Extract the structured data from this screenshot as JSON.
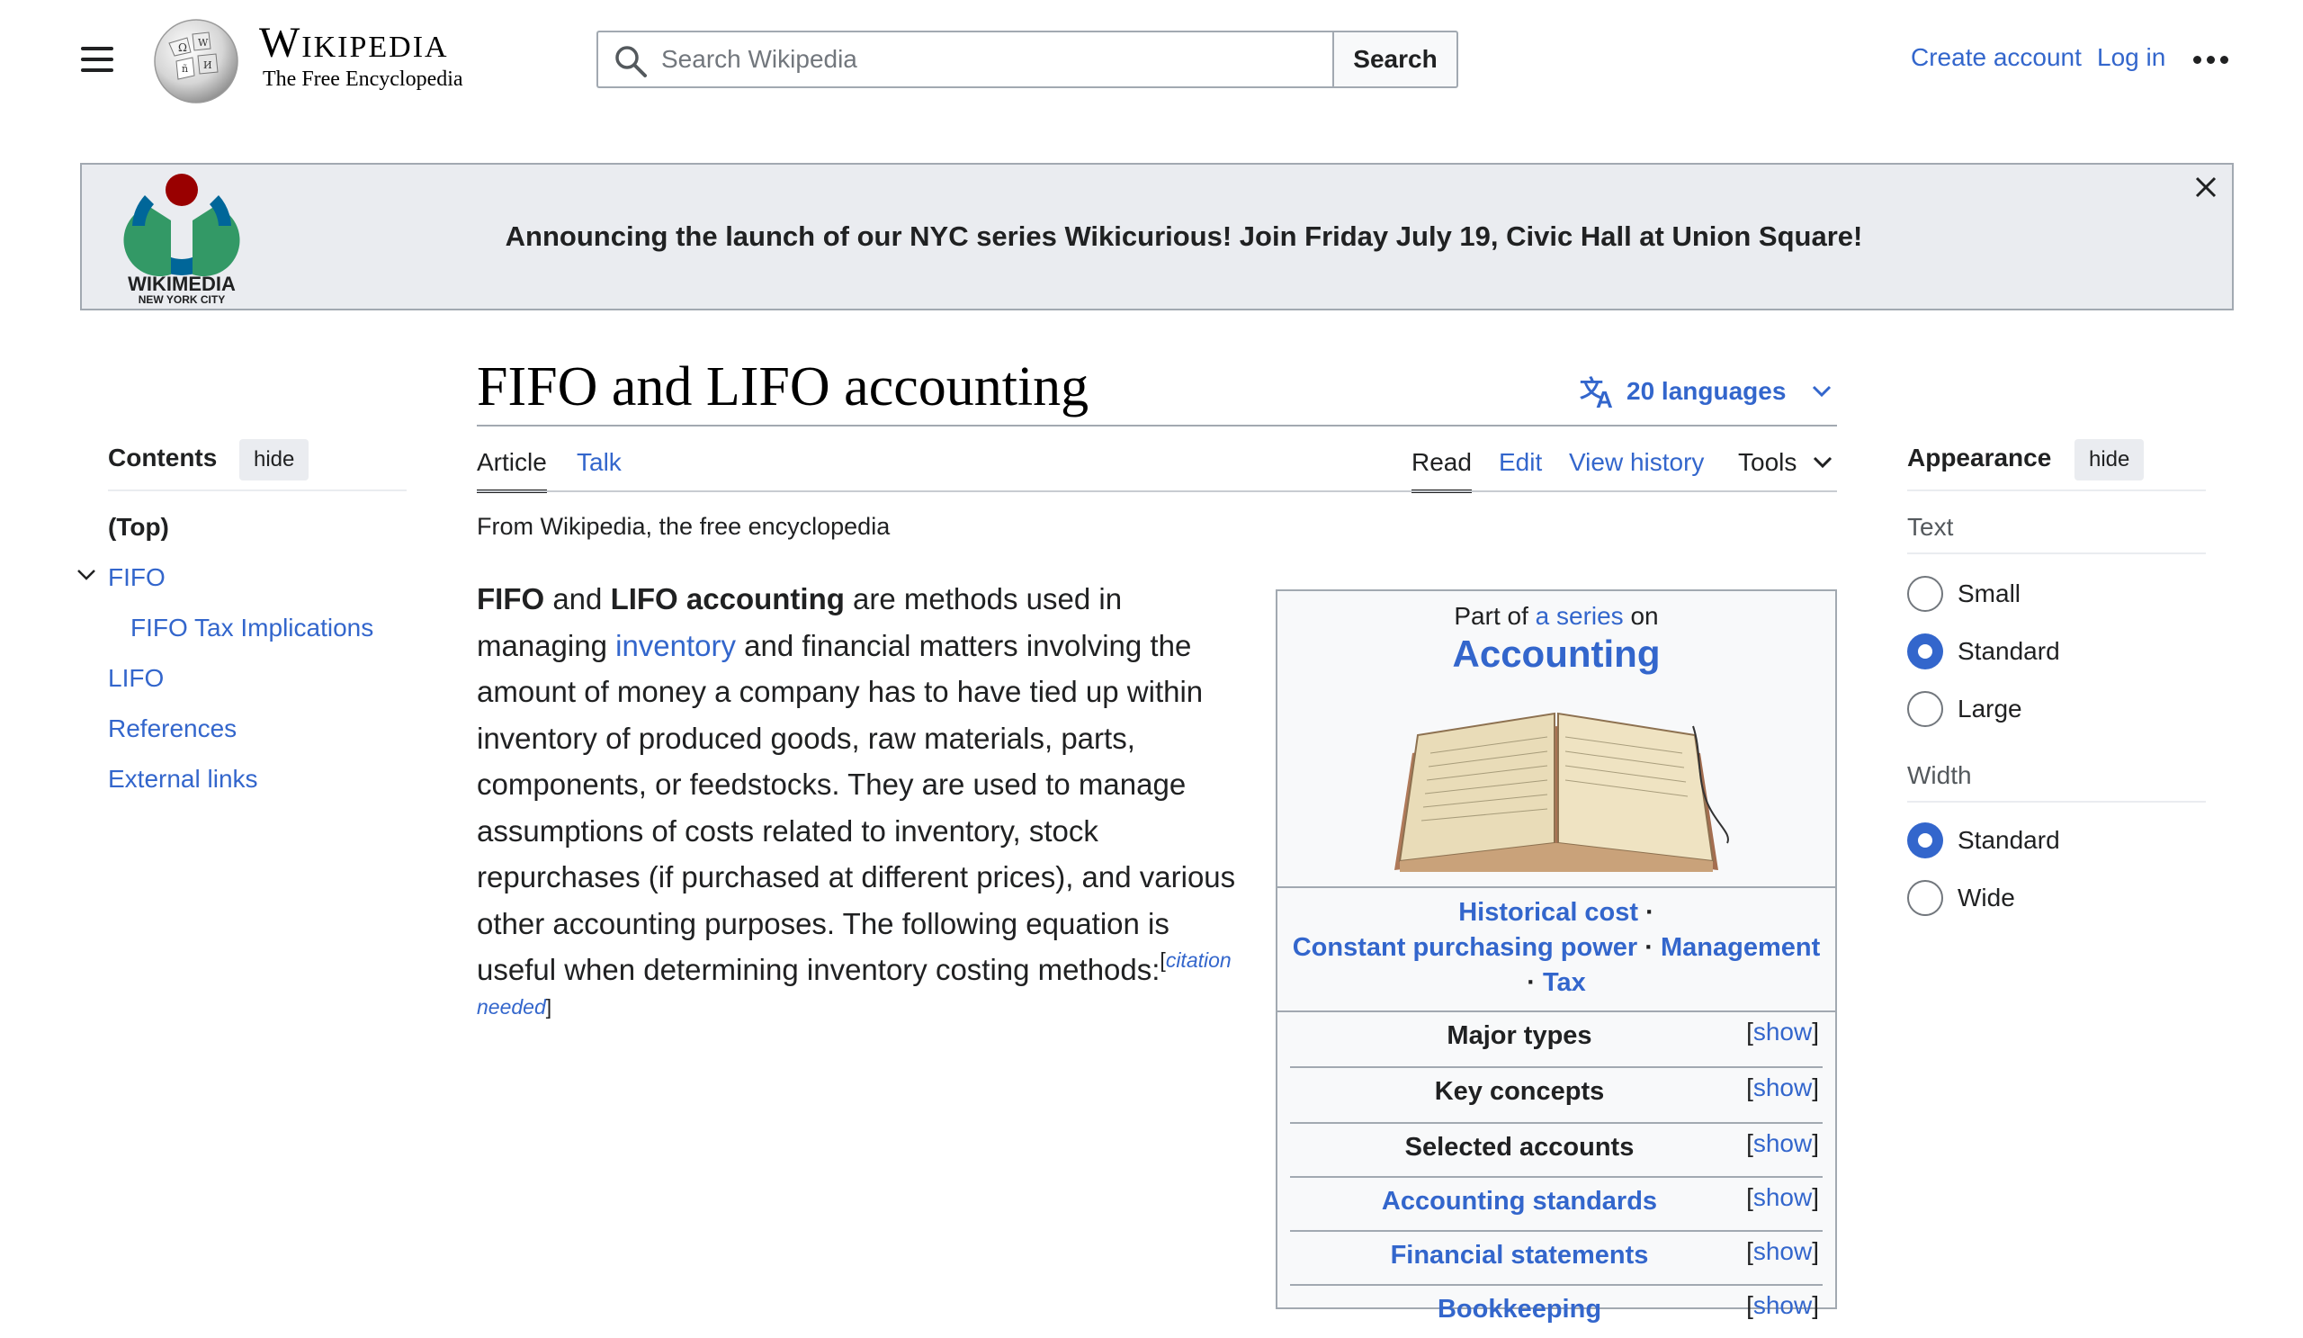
{
  "header": {
    "wordmark_title": "Wikipedia",
    "wordmark_tagline": "The Free Encyclopedia",
    "search_placeholder": "Search Wikipedia",
    "search_button": "Search",
    "create_account": "Create account",
    "log_in": "Log in"
  },
  "banner": {
    "logo_text": "WIKIMEDIA",
    "logo_subtext": "NEW YORK CITY",
    "message": "Announcing the launch of our NYC series Wikicurious! Join Friday July 19, Civic Hall at Union Square!"
  },
  "page": {
    "title": "FIFO and LIFO accounting",
    "languages": "20 languages",
    "tabs_left": [
      "Article",
      "Talk"
    ],
    "tabs_right": [
      "Read",
      "Edit",
      "View history",
      "Tools"
    ],
    "from_line": "From Wikipedia, the free encyclopedia"
  },
  "toc": {
    "title": "Contents",
    "hide": "hide",
    "items": [
      "(Top)",
      "FIFO",
      "FIFO Tax Implications",
      "LIFO",
      "References",
      "External links"
    ]
  },
  "appearance": {
    "title": "Appearance",
    "hide": "hide",
    "text_label": "Text",
    "text_options": [
      "Small",
      "Standard",
      "Large"
    ],
    "text_selected": "Standard",
    "width_label": "Width",
    "width_options": [
      "Standard",
      "Wide"
    ],
    "width_selected": "Standard"
  },
  "article": {
    "bold1": "FIFO",
    "and1": " and ",
    "bold2": "LIFO accounting",
    "text1": " are methods used in managing ",
    "link1": "inventory",
    "text2": " and financial matters involving the amount of money a company has to have tied up within inventory of produced goods, raw materials, parts, components, or feedstocks. They are used to manage assumptions of costs related to inventory, stock repurchases (if purchased at different prices), and various other accounting purposes. The following equation is useful when determining inventory costing methods:",
    "citation": "citation needed"
  },
  "infobox": {
    "part_of": "Part of ",
    "series_link": "a series",
    "on": " on",
    "heading": "Accounting",
    "topic1": "Historical cost",
    "topic2": "Constant purchasing power",
    "topic3": "Management",
    "topic4": "Tax",
    "rows": [
      "Major types",
      "Key concepts",
      "Selected accounts",
      "Accounting standards",
      "Financial statements",
      "Bookkeeping"
    ],
    "show": "show"
  },
  "colors": {
    "link": "#3366cc",
    "text": "#202122",
    "banner_bg": "#eaecf0",
    "infobox_bg": "#f8f9fa"
  }
}
